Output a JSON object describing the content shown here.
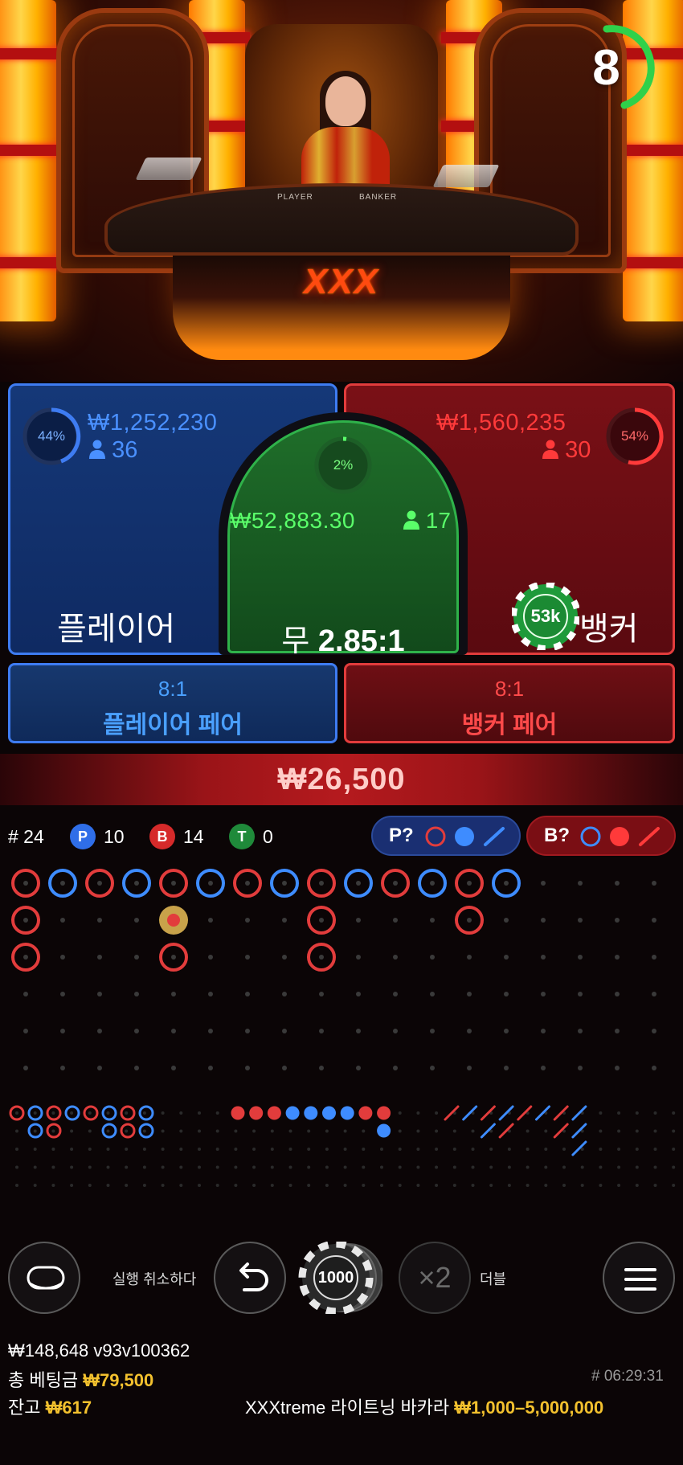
{
  "timer": {
    "seconds": "8",
    "color": "#2fd14a"
  },
  "table_labels": {
    "player": "PLAYER",
    "banker": "BANKER",
    "logo": "XXX"
  },
  "player": {
    "name": "플레이어",
    "percent": "44%",
    "amount": "₩1,252,230",
    "count": "36",
    "color": "#3e7cf2"
  },
  "banker": {
    "name": "뱅커",
    "percent": "54%",
    "amount": "₩1,560,235",
    "count": "30",
    "color": "#e23c3c"
  },
  "tie": {
    "percent": "2%",
    "amount": "₩52,883.30",
    "count": "17",
    "name": "무",
    "odds": "2.85:1",
    "color": "#2fb24a"
  },
  "chip_on_banker": "53k",
  "side_bets": {
    "player_pair": {
      "odds": "8:1",
      "name": "플레이어 페어"
    },
    "banker_pair": {
      "odds": "8:1",
      "name": "뱅커 페어"
    }
  },
  "total_bet_display": "₩26,500",
  "stats": {
    "rounds": "# 24",
    "p_label": "P",
    "p_count": "10",
    "b_label": "B",
    "b_count": "14",
    "t_label": "T",
    "t_count": "0"
  },
  "ask": {
    "player": "P?",
    "banker": "B?"
  },
  "controls": {
    "undo_label": "실행 취소하다",
    "chip_value": "1000",
    "double_symbol": "×2",
    "double_label": "더블"
  },
  "footer": {
    "balance_id": "₩148,648 v93v100362",
    "total_bet_label": "총 베팅금",
    "total_bet_value": "₩79,500",
    "balance_label": "잔고",
    "balance_value": "₩617",
    "round_id": "# 06:29:31",
    "table_name": "XXXtreme 라이트닝 바카라",
    "limits": "₩1,000–5,000,000"
  },
  "colors": {
    "player": "#3e7cf2",
    "banker": "#e23c3c",
    "tie": "#2fb24a",
    "gold": "#f3c12e"
  }
}
